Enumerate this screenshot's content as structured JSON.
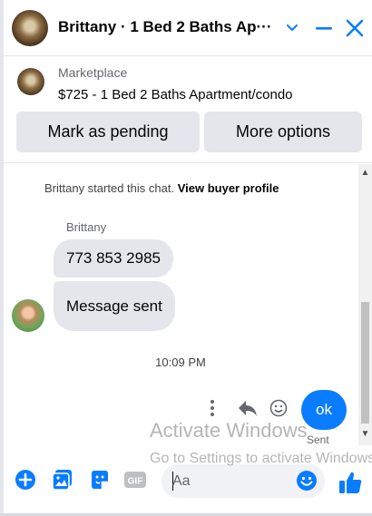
{
  "header": {
    "title": "Brittany · 1 Bed 2 Baths Ap···",
    "avatar_icon": "listing-photo",
    "icons": [
      "chevron-down-icon",
      "minimize-icon",
      "close-icon"
    ],
    "accent": "#0a7cff"
  },
  "marketplace": {
    "source": "Marketplace",
    "listing": "$725 - 1 Bed 2 Baths Apartment/condo",
    "mark_pending_label": "Mark as pending",
    "more_options_label": "More options"
  },
  "chat": {
    "started_text": "Brittany started this chat.",
    "view_profile_label": "View buyer profile",
    "sender_name": "Brittany",
    "messages": [
      {
        "text": "773 853 2985"
      },
      {
        "text": "Message sent"
      }
    ],
    "timestamp": "10:09 PM",
    "reply_icons": [
      "more-vertical-icon",
      "reply-icon",
      "react-emoji-icon"
    ],
    "my_message": "ok",
    "status": "Sent"
  },
  "composer": {
    "tools": [
      "plus-icon",
      "photo-icon",
      "sticker-icon",
      "gif-icon"
    ],
    "gif_label": "GIF",
    "placeholder": "Aa",
    "emoji_icon": "emoji-icon",
    "send_icon": "thumbs-up-icon"
  },
  "watermark": {
    "line1": "Activate Windows",
    "line2": "Go to Settings to activate Windows."
  }
}
